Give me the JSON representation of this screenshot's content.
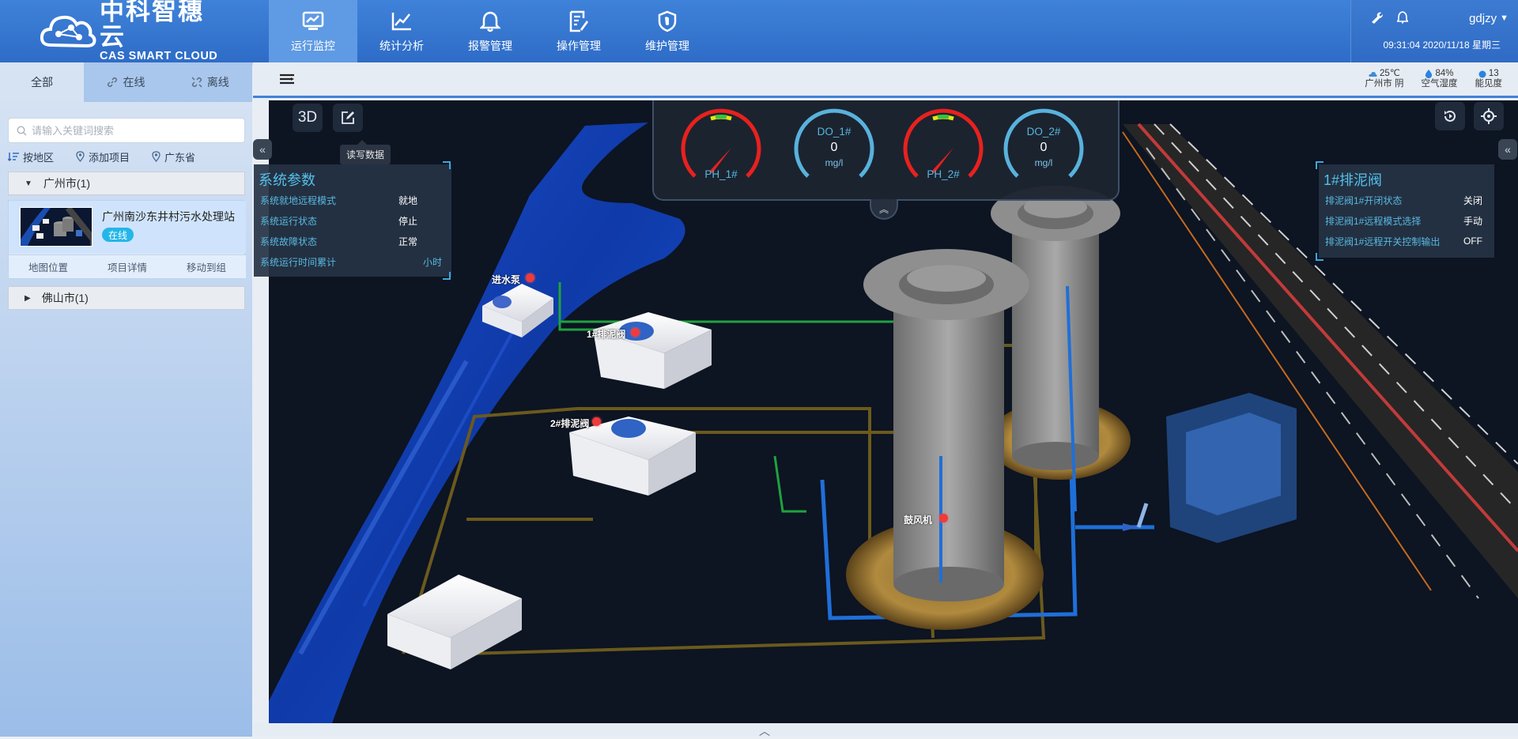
{
  "header": {
    "logo_cn": "中科智穗云",
    "logo_en": "CAS SMART CLOUD",
    "nav": [
      {
        "label": "运行监控",
        "icon": "monitor-chart-icon"
      },
      {
        "label": "统计分析",
        "icon": "line-chart-icon"
      },
      {
        "label": "报警管理",
        "icon": "bell-icon"
      },
      {
        "label": "操作管理",
        "icon": "edit-document-icon"
      },
      {
        "label": "维护管理",
        "icon": "shield-wrench-icon"
      }
    ],
    "user": "gdjzy",
    "datetime": "09:31:04 2020/11/18 星期三"
  },
  "sidebar": {
    "tabs": [
      {
        "label": "全部"
      },
      {
        "label": "在线"
      },
      {
        "label": "离线"
      }
    ],
    "search_placeholder": "请输入关键词搜索",
    "filters": {
      "by_region": "按地区",
      "add_project": "添加项目",
      "province": "广东省"
    },
    "groups": [
      {
        "label": "广州市(1)",
        "expanded": true
      },
      {
        "label": "佛山市(1)",
        "expanded": false
      }
    ],
    "project": {
      "name": "广州南沙东井村污水处理站",
      "status": "在线",
      "actions": [
        "地图位置",
        "项目详情",
        "移动到组"
      ]
    }
  },
  "weather": {
    "temp": "25℃",
    "city": "广州市 阴",
    "humidity": "84%",
    "humidity_label": "空气湿度",
    "visibility": "13",
    "visibility_label": "能见度"
  },
  "scene": {
    "mode_button": "3D",
    "tooltip": "读写数据",
    "system_panel": {
      "title": "系统参数",
      "rows": [
        {
          "k": "系统就地远程模式",
          "v": "就地"
        },
        {
          "k": "系统运行状态",
          "v": "停止"
        },
        {
          "k": "系统故障状态",
          "v": "正常"
        },
        {
          "k": "系统运行时间累计",
          "v": "小时"
        }
      ]
    },
    "valve_panel": {
      "title": "1#排泥阀",
      "rows": [
        {
          "k": "排泥阀1#开闭状态",
          "v": "关闭"
        },
        {
          "k": "排泥阀1#远程模式选择",
          "v": "手动"
        },
        {
          "k": "排泥阀1#远程开关控制输出",
          "v": "OFF"
        }
      ]
    },
    "gauges": [
      {
        "label": "PH_1#",
        "value": "",
        "unit": "",
        "type": "ph"
      },
      {
        "label": "DO_1#",
        "value": "0",
        "unit": "mg/l",
        "type": "do"
      },
      {
        "label": "PH_2#",
        "value": "",
        "unit": "",
        "type": "ph"
      },
      {
        "label": "DO_2#",
        "value": "0",
        "unit": "mg/l",
        "type": "do"
      }
    ],
    "equipment_labels": {
      "pump": "进水泵",
      "valve1": "1#排泥阀",
      "valve2": "2#排泥阀",
      "blower": "鼓风机"
    }
  },
  "colors": {
    "header_blue": "#3f82d9",
    "online_badge": "#23b6e8",
    "panel_accent": "#54c0ea",
    "alarm_red": "#ee3b3b"
  }
}
